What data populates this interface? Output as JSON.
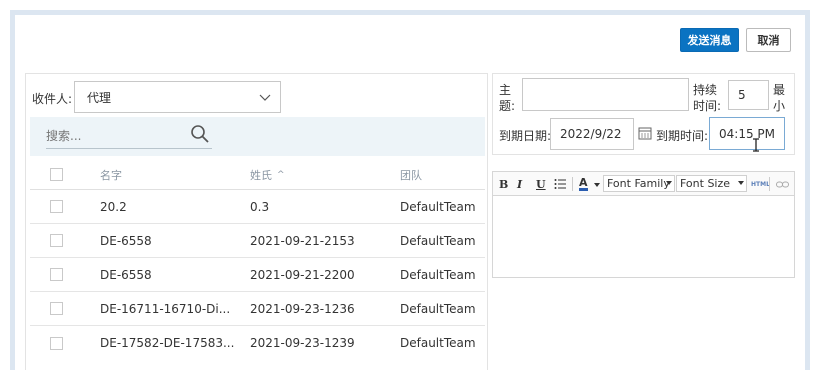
{
  "actions": {
    "send_label": "发送消息",
    "cancel_label": "取消"
  },
  "recipient": {
    "label": "收件人:",
    "selected": "代理"
  },
  "search": {
    "placeholder": "搜索..."
  },
  "table": {
    "headers": {
      "name": "名字",
      "last_name": "姓氏",
      "team": "团队"
    },
    "sort_indicator": "^",
    "rows": [
      {
        "name": "20.2",
        "last_name": "0.3",
        "team": "DefaultTeam"
      },
      {
        "name": "DE-6558",
        "last_name": "2021-09-21-2153",
        "team": "DefaultTeam"
      },
      {
        "name": "DE-6558",
        "last_name": "2021-09-21-2200",
        "team": "DefaultTeam"
      },
      {
        "name": "DE-16711-16710-Di...",
        "last_name": "2021-09-23-1236",
        "team": "DefaultTeam"
      },
      {
        "name": "DE-17582-DE-17583...",
        "last_name": "2021-09-23-1239",
        "team": "DefaultTeam"
      }
    ]
  },
  "message": {
    "subject_label_1": "主",
    "subject_label_2": "题:",
    "subject_value": "",
    "duration_label_1": "持续",
    "duration_label_2": "时间:",
    "duration_value": "5",
    "duration_unit_1": "最",
    "duration_unit_2": "小",
    "due_date_label": "到期日期:",
    "due_date_value": "2022/9/22",
    "due_time_label": "到期时间:",
    "due_time_value": "04:15 PM"
  },
  "editor": {
    "font_family": "Font Family",
    "font_size": "Font Size",
    "html_label": "HTML",
    "bold": "B",
    "italic": "I",
    "underline": "U",
    "color_letter": "A"
  },
  "colors": {
    "primary": "#0a73c2",
    "search_bg": "#edf4f8",
    "frame": "#dce6f1"
  },
  "icons": [
    "chevron-down-icon",
    "search-icon",
    "calendar-icon",
    "list-icon",
    "link-icon",
    "text-cursor-icon"
  ]
}
